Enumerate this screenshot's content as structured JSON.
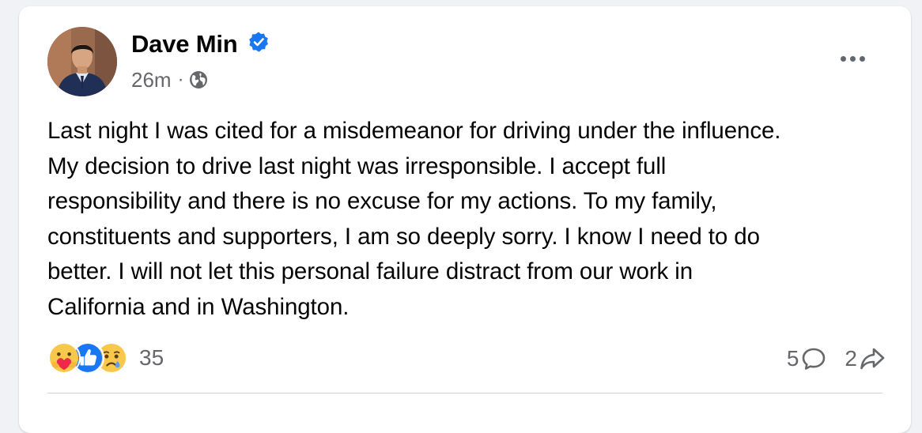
{
  "post": {
    "author": "Dave Min",
    "time": "26m",
    "separator": "·",
    "text": "Last night I was cited for a misdemeanor for driving under the influence.\nMy decision to drive last night was irresponsible. I accept full\nresponsibility and there is no excuse for my actions. To my family,\nconstituents and supporters, I am so deeply sorry. I know I need to do\nbetter. I will not let this personal failure distract from our work in\nCalifornia and in Washington.",
    "reactions": {
      "types": [
        "care",
        "like",
        "sad"
      ],
      "count": "35"
    },
    "comments_count": "5",
    "shares_count": "2"
  },
  "icons": {
    "verified": "verified-badge-icon",
    "audience": "globe-icon",
    "more": "more-options-icon",
    "comment": "comment-icon",
    "share": "share-icon"
  },
  "colors": {
    "verified_blue": "#1877f2",
    "like_blue": "#1877f2",
    "secondary_text": "#65676b",
    "primary_text": "#050505"
  }
}
